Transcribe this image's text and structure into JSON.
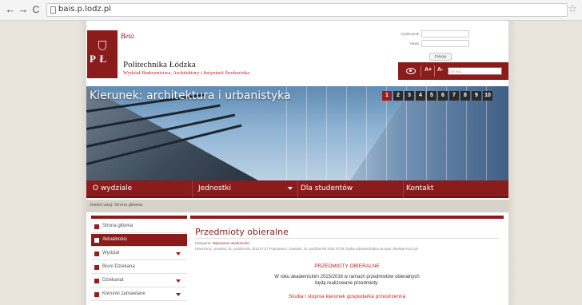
{
  "browser": {
    "url": "bais.p.lodz.pl"
  },
  "header": {
    "beta": "Beta",
    "logo_text": "P Ł",
    "university": "Politechnika Łódzka",
    "faculty": "Wydział Budownictwa, Architektury i Inżynierii Środowiska"
  },
  "login": {
    "user_label": "Użytkownik",
    "pass_label": "Hasło",
    "button": "Zaloguj"
  },
  "accessibility": {
    "font_up": "A+",
    "font_down": "A-",
    "search_placeholder": "Szukaj..."
  },
  "banner": {
    "title": "Kierunek: architektura i urbanistyka",
    "slides": [
      "1",
      "2",
      "3",
      "4",
      "5",
      "6",
      "7",
      "8",
      "9",
      "10"
    ],
    "active_slide": "1"
  },
  "nav": {
    "items": [
      {
        "label": "O wydziale"
      },
      {
        "label": "Jednostki"
      },
      {
        "label": "Dla studentów"
      },
      {
        "label": "Kontakt"
      }
    ]
  },
  "breadcrumb": "Jesteś tutaj: Strona główna",
  "sidebar": {
    "items": [
      {
        "label": "Strona główna"
      },
      {
        "label": "Aktualności"
      },
      {
        "label": "Wydział"
      },
      {
        "label": "Biuro Dziekana"
      },
      {
        "label": "Dziekanat"
      },
      {
        "label": "Kierunki zamawiane"
      }
    ]
  },
  "article": {
    "title": "Przedmioty obieralne",
    "category_label": "Kategoria: ",
    "category_value": "Najnowsze wiadomości",
    "meta": "Utworzono: czwartek, 01, październik 2015 07:27    Poprawiono: czwartek, 01, październik 2015 07:29    Osoba odpowiedzialna za wpis: Wiesław Kurczyk",
    "section_heading": "PRZEDMIOTY OBIERALNE",
    "body_line1": "W roku akademickim 2015/2016 w ramach przedmiotów obieralnych",
    "body_line2": "będą realizowane przedmioty:",
    "sub_heading": "Studia I stopnia  kierunek gospodarka przestrzenna"
  }
}
